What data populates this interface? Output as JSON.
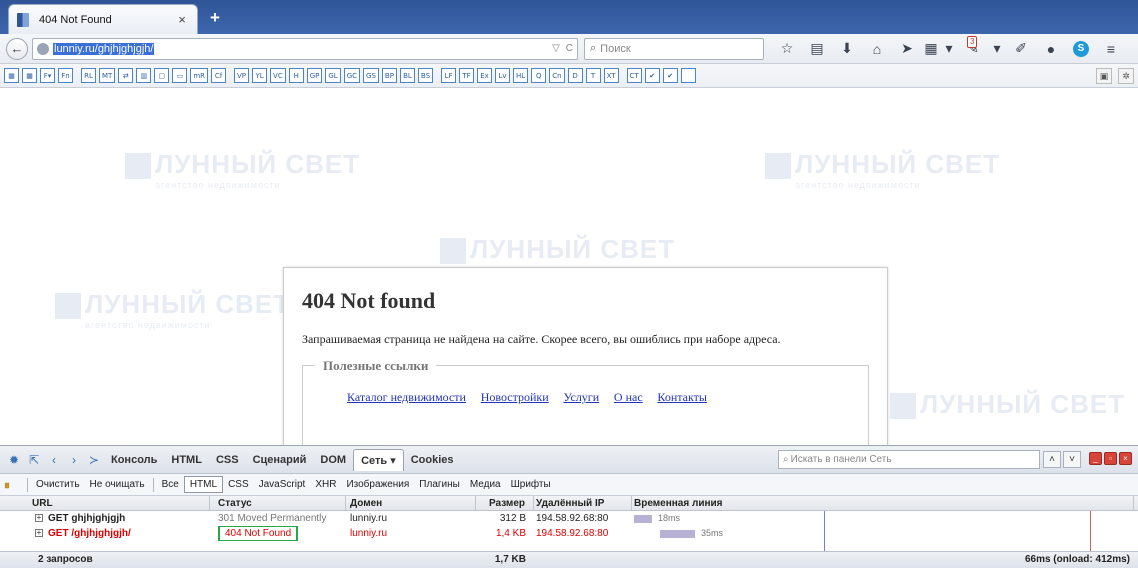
{
  "browser": {
    "tab_title": "404 Not Found",
    "close_glyph": "×",
    "new_tab_glyph": "+",
    "url": "lunniy.ru/ghjhjghjgjh/",
    "search_placeholder": "Поиск",
    "notification_count": "3"
  },
  "toolbar_buttons": [
    "F▾",
    "Fn",
    "RL",
    "MT",
    "⇄",
    "▥",
    "▢",
    "▭",
    "mR",
    "Cf",
    "VP",
    "YL",
    "VC",
    "H",
    "GP",
    "GL",
    "GC",
    "GS",
    "BP",
    "BL",
    "BS",
    "LF",
    "TF",
    "Ex",
    "Lv",
    "HL",
    "Q",
    "Cn",
    "D",
    "T",
    "XT",
    "CT",
    "✔",
    "✔",
    ""
  ],
  "watermark": {
    "brand": "ЛУННЫЙ СВЕТ",
    "tagline": "агентство недвижимости"
  },
  "error_page": {
    "heading": "404 Not found",
    "message": "Запрашиваемая страница не найдена на сайте. Скорее всего, вы ошиблись при наборе адреса.",
    "links_legend": "Полезные ссылки",
    "links": [
      "Каталог недвижимости",
      "Новостройки",
      "Услуги",
      "О нас",
      "Контакты"
    ]
  },
  "firebug": {
    "tabs": [
      "Консоль",
      "HTML",
      "CSS",
      "Сценарий",
      "DOM",
      "Сеть ▾",
      "Cookies"
    ],
    "active_tab": "Сеть ▾",
    "search_placeholder": "Искать в панели Сеть",
    "net_toolbar": {
      "clear": "Очистить",
      "persist": "Не очищать",
      "filters": [
        "Все",
        "HTML",
        "CSS",
        "JavaScript",
        "XHR",
        "Изображения",
        "Плагины",
        "Медиа",
        "Шрифты"
      ],
      "active_filter": "HTML"
    },
    "columns": {
      "url": "URL",
      "status": "Статус",
      "domain": "Домен",
      "size": "Размер",
      "ip": "Удалённый IP",
      "timeline": "Временная линия"
    },
    "requests": [
      {
        "url": "GET ghjhjghjgjh",
        "status": "301 Moved Permanently",
        "domain": "lunniy.ru",
        "size": "312 B",
        "ip": "194.58.92.68:80",
        "time": "18ms",
        "error": false,
        "start_pct": 0,
        "dur_pct": 3.6
      },
      {
        "url": "GET /ghjhjghjgjh/",
        "status": "404 Not Found",
        "domain": "lunniy.ru",
        "size": "1,4 KB",
        "ip": "194.58.92.68:80",
        "time": "35ms",
        "error": true,
        "start_pct": 5.2,
        "dur_pct": 7.0
      }
    ],
    "summary": {
      "count": "2 запросов",
      "size": "1,7 KB",
      "time": "66ms (onload: 412ms)"
    }
  },
  "colors": {
    "accent": "#2f5597",
    "error": "#dd0000",
    "status_highlight": "#27a745",
    "timeline_bar": "#b7b1d6"
  }
}
